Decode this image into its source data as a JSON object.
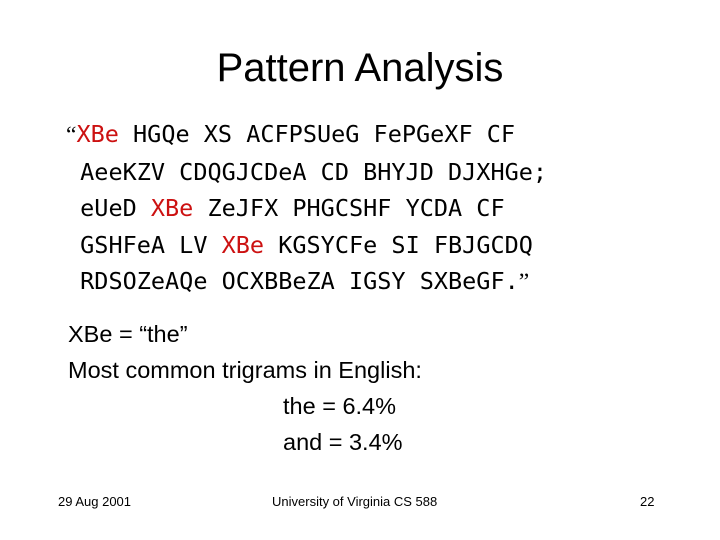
{
  "title": "Pattern Analysis",
  "cipher_lines": [
    [
      {
        "t": "“",
        "q": 1
      },
      {
        "t": "XBe",
        "red": 1
      },
      {
        "t": " HGQe XS ACFPSUeG FePGeXF CF"
      }
    ],
    [
      {
        "t": " AeeKZV CDQGJCDeA CD BHYJD DJXHGe;"
      }
    ],
    [
      {
        "t": " eUeD "
      },
      {
        "t": "XBe",
        "red": 1
      },
      {
        "t": " ZeJFX PHGCSHF YCDA CF"
      }
    ],
    [
      {
        "t": " GSHFeA LV "
      },
      {
        "t": "XBe",
        "red": 1
      },
      {
        "t": " KGSYCFe SI FBJGCDQ"
      }
    ],
    [
      {
        "t": " RDSOZeAQe OCXBBeZA IGSY SXBeGF."
      },
      {
        "t": "”",
        "q": 1
      }
    ]
  ],
  "notes": {
    "mapping": "XBe = “the”",
    "heading": "Most common trigrams in English:",
    "items": [
      "the = 6.4%",
      "and = 3.4%"
    ]
  },
  "footer": {
    "date": "29 Aug 2001",
    "course": "University of Virginia CS 588",
    "page": "22"
  },
  "colors": {
    "highlight": "#cc1111"
  }
}
